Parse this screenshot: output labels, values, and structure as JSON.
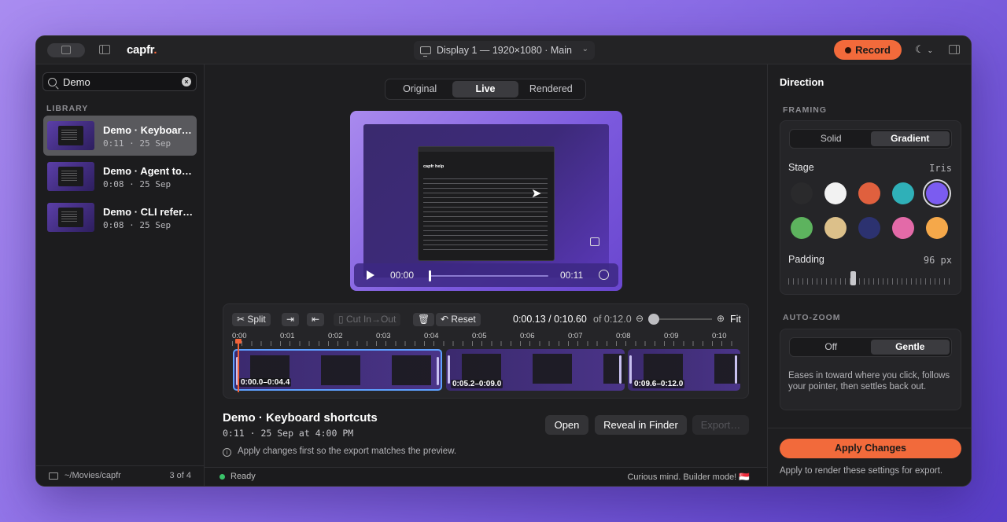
{
  "app": {
    "logo": "capfr",
    "logo_dot": "."
  },
  "titlebar": {
    "display": "Display 1 — 1920×1080 · Main",
    "record_label": "Record",
    "moon_glyph": "☾"
  },
  "sidebar": {
    "search_value": "Demo",
    "section_label": "LIBRARY",
    "items": [
      {
        "title": "Demo · Keyboard shortcuts",
        "meta": "0:11 · 25 Sep"
      },
      {
        "title": "Demo · Agent tools",
        "meta": "0:08 · 25 Sep"
      },
      {
        "title": "Demo · CLI reference",
        "meta": "0:08 · 25 Sep"
      }
    ],
    "footer_path": "~/Movies/capfr",
    "footer_count": "3 of 4"
  },
  "main": {
    "view_tabs": [
      "Original",
      "Live",
      "Rendered"
    ],
    "active_tab": "Live",
    "preview": {
      "window_heading": "capfr help",
      "time_current": "00:00",
      "time_duration": "00:11",
      "progress": 0.0
    },
    "timeline": {
      "buttons": {
        "split": "Split",
        "cut": "Cut In→Out",
        "reset": "Reset"
      },
      "time_readout": "0:00.13 / 0:10.60",
      "time_of": "of 0:12.0",
      "fit": "Fit",
      "ruler_labels": [
        "0:00",
        "0:01",
        "0:02",
        "0:03",
        "0:04",
        "0:05",
        "0:06",
        "0:07",
        "0:08",
        "0:09",
        "0:10"
      ],
      "clips": [
        {
          "label": "0:00.0–0:04.4",
          "selected": true
        },
        {
          "label": "0:05.2–0:09.0",
          "selected": false
        },
        {
          "label": "0:09.6–0:12.0",
          "selected": false
        }
      ]
    },
    "recording": {
      "title": "Demo · Keyboard shortcuts",
      "meta": "0:11 · 25 Sep at 4:00 PM",
      "hint": "Apply changes first so the export matches the preview.",
      "open_label": "Open",
      "reveal_label": "Reveal in Finder",
      "export_label": "Export…"
    },
    "status": {
      "text": "Ready",
      "right": "Curious mind. Builder mode! 🇸🇬"
    }
  },
  "panel": {
    "title": "Direction",
    "framing": {
      "label": "FRAMING",
      "options": [
        "Solid",
        "Gradient"
      ],
      "active": "Gradient",
      "stage_label": "Stage",
      "stage_value": "Iris",
      "swatches": [
        "#2a2a2c",
        "#f2f2f2",
        "#e0603e",
        "#2fb0b8",
        "#7b5cf0",
        "#5db35e",
        "#dcc08a",
        "#2c3270",
        "#e36aa8",
        "#f5a84a"
      ],
      "selected_swatch": 4,
      "padding_label": "Padding",
      "padding_value": "96 px"
    },
    "auto_zoom": {
      "label": "AUTO-ZOOM",
      "options": [
        "Off",
        "Gentle"
      ],
      "active": "Gentle",
      "description": "Eases in toward where you click, follows your pointer, then settles back out."
    },
    "apply_label": "Apply Changes",
    "apply_hint": "Apply to render these settings for export."
  }
}
